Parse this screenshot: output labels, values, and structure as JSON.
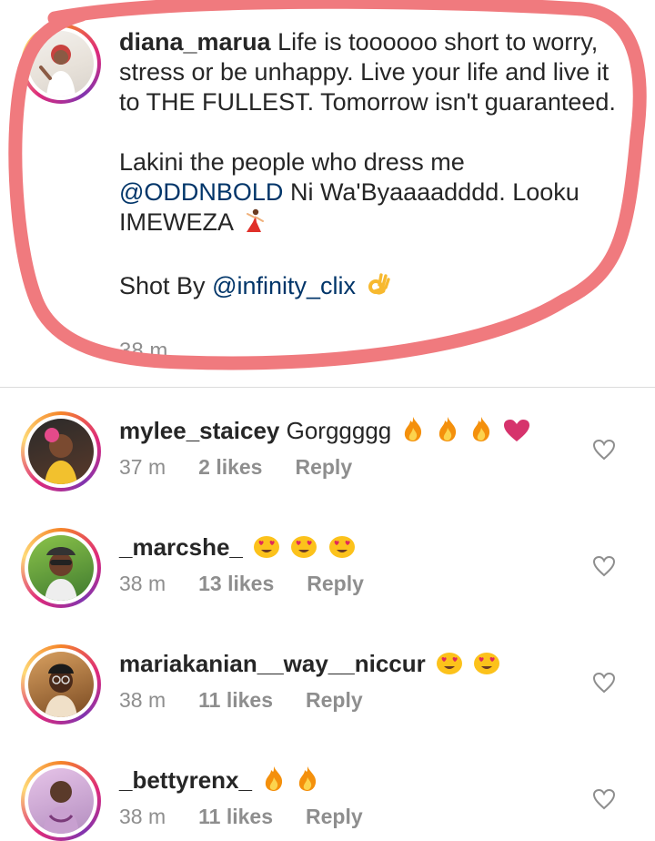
{
  "caption": {
    "username": "diana_marua",
    "text1": " Life is toooooo short to worry, stress or be unhappy. Live your life and live it to THE FULLEST. Tomorrow isn't guaranteed.",
    "text2a": "Lakini the people who dress me ",
    "mention1": "@ODDNBOLD",
    "text2b": " Ni Wa'Byaaaadddd. Looku IMEWEZA",
    "text3a": "Shot By ",
    "mention2": "@infinity_clix",
    "time": "38 m"
  },
  "comments": [
    {
      "username": "mylee_staicey",
      "text": " Gorggggg",
      "emojis": [
        "fire-emoji",
        "fire-emoji",
        "fire-emoji",
        "pink-heart-emoji"
      ],
      "time": "37 m",
      "likes": "2 likes",
      "reply": "Reply"
    },
    {
      "username": "_marcshe_",
      "text": "",
      "emojis": [
        "heart-eyes-emoji",
        "heart-eyes-emoji",
        "heart-eyes-emoji"
      ],
      "time": "38 m",
      "likes": "13 likes",
      "reply": "Reply"
    },
    {
      "username": "mariakanian__way__niccur",
      "text": "",
      "emojis": [
        "heart-eyes-emoji",
        "heart-eyes-emoji"
      ],
      "time": "38 m",
      "likes": "11 likes",
      "reply": "Reply"
    },
    {
      "username": "_bettyrenx_",
      "text": "",
      "emojis": [
        "fire-emoji",
        "fire-emoji"
      ],
      "time": "38 m",
      "likes": "11 likes",
      "reply": "Reply"
    }
  ],
  "colors": {
    "text": "#262626",
    "muted": "#8e8e8e",
    "mention": "#003569",
    "scribble": "#f07a7e"
  }
}
